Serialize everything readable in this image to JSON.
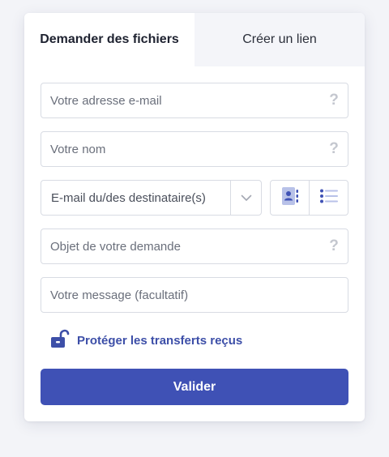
{
  "tabs": [
    {
      "label": "Demander des fichiers",
      "active": true
    },
    {
      "label": "Créer un lien",
      "active": false
    }
  ],
  "form": {
    "email_placeholder": "Votre adresse e-mail",
    "name_placeholder": "Votre nom",
    "recipients_placeholder": "E-mail du/des destinataire(s)",
    "subject_placeholder": "Objet de votre demande",
    "message_placeholder": "Votre message (facultatif)",
    "help_glyph": "?"
  },
  "icons": {
    "help": "question-mark-icon",
    "chevron": "chevron-down-icon",
    "contacts": "contact-book-icon",
    "list": "list-icon",
    "lock": "unlocked-padlock-icon"
  },
  "protect": {
    "label": "Protéger les transferts reçus"
  },
  "submit": {
    "label": "Valider"
  },
  "colors": {
    "accent": "#3f51b5",
    "link": "#3d4fa8",
    "border": "#d8dbe3",
    "icon_muted": "#c4c7cf"
  }
}
